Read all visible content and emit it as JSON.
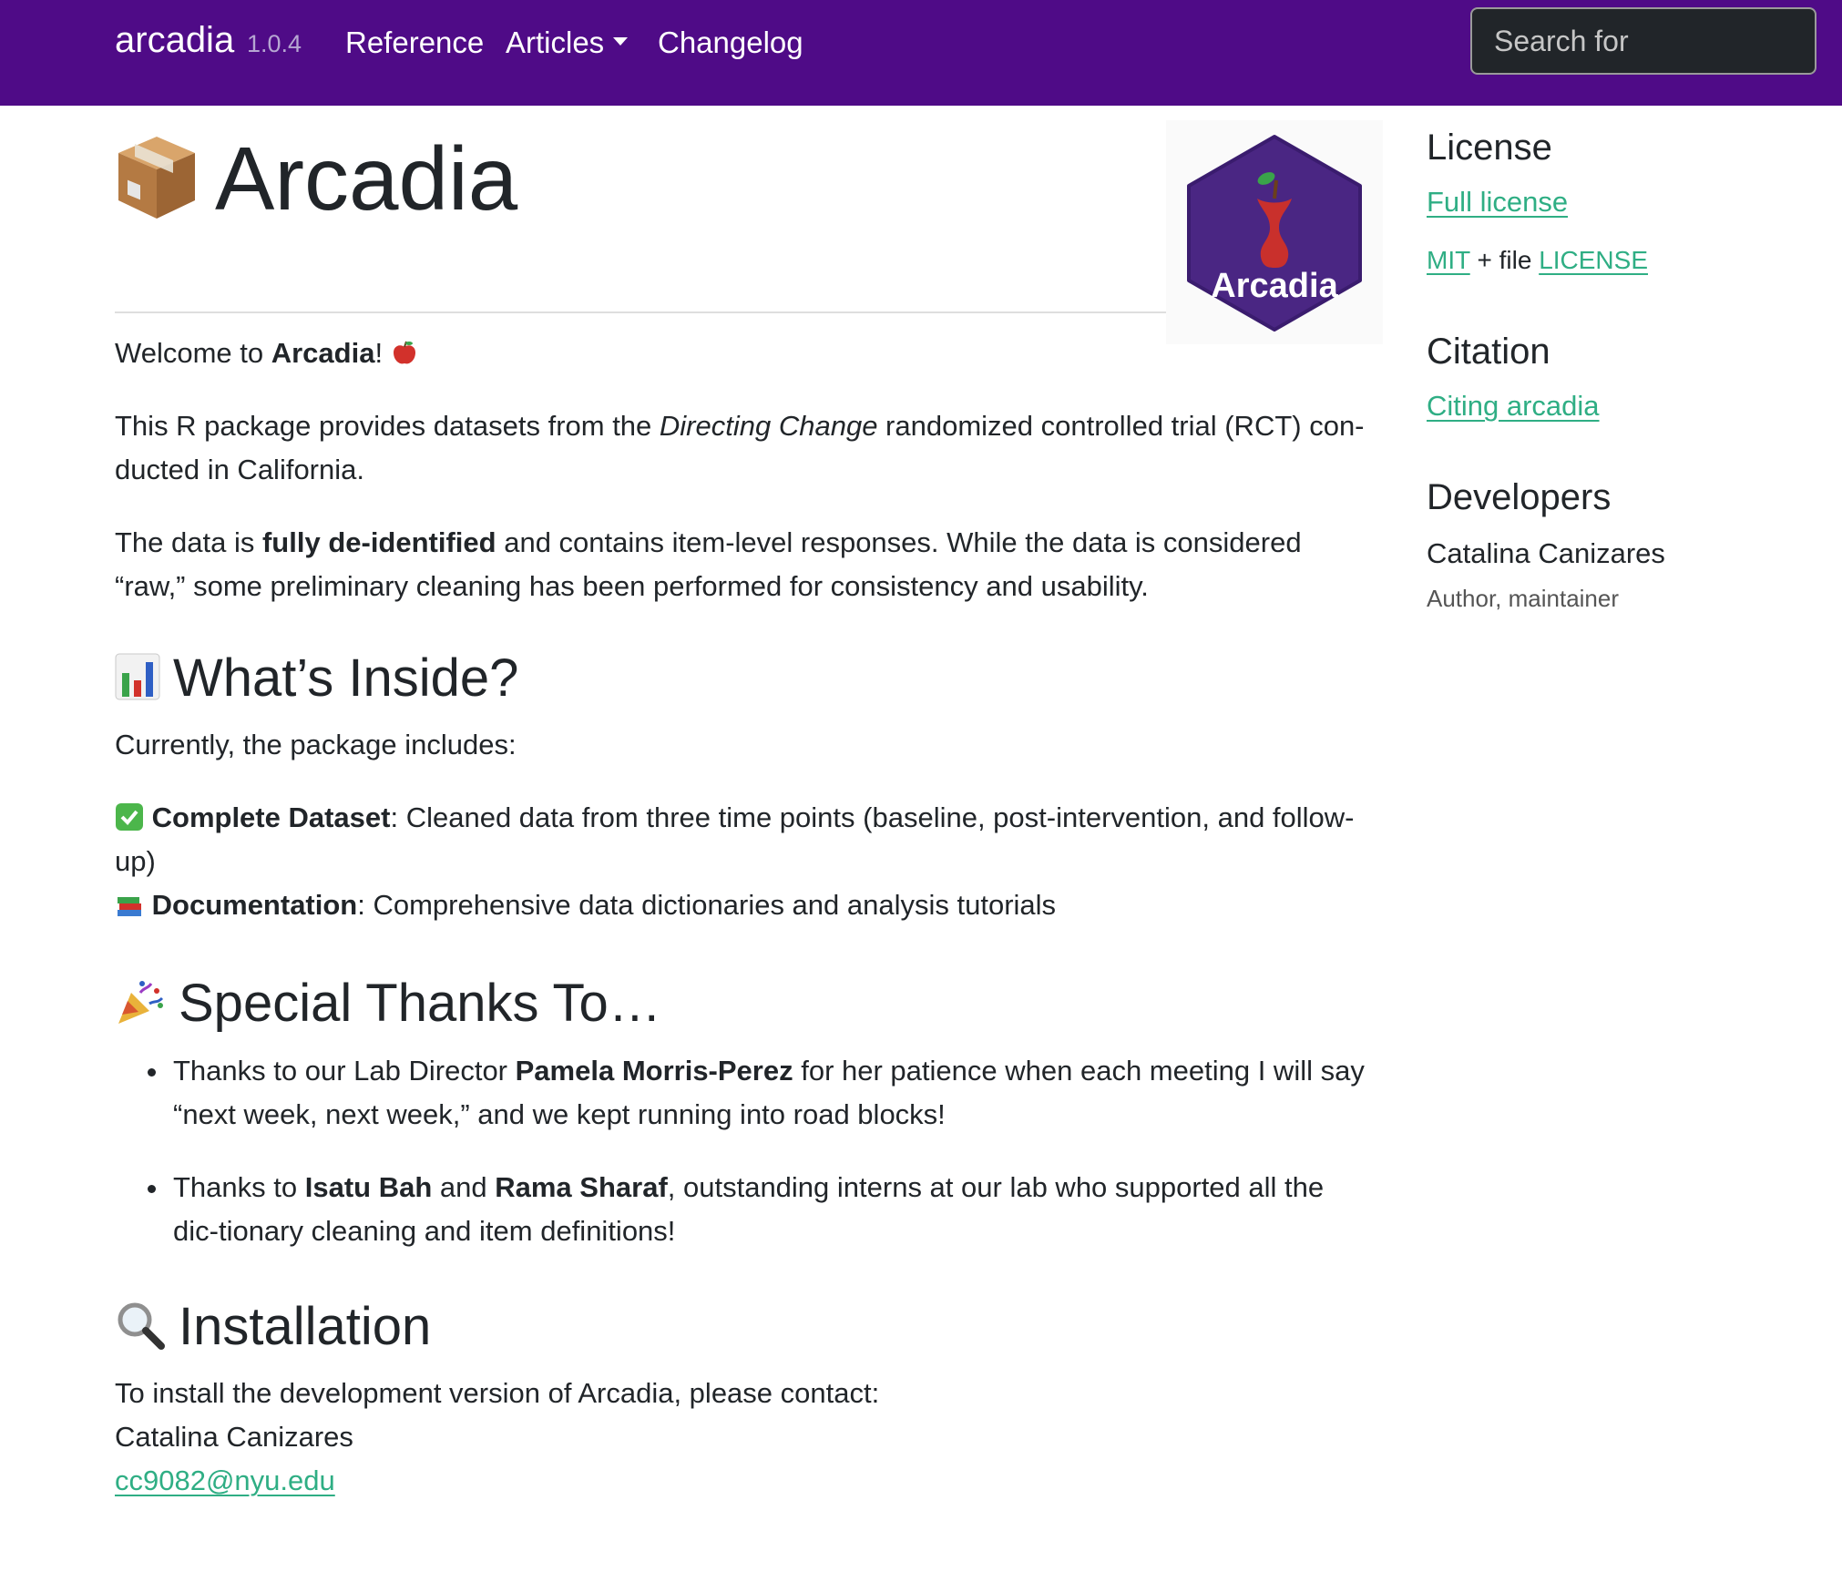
{
  "navbar": {
    "brand": "arcadia",
    "version": "1.0.4",
    "links": [
      {
        "label": "Reference"
      },
      {
        "label": "Articles"
      },
      {
        "label": "Changelog"
      }
    ],
    "search_placeholder": "Search for"
  },
  "main": {
    "title": "Arcadia",
    "logo_text": "Arcadia",
    "welcome": {
      "pre": "Welcome to ",
      "bold": "Arcadia",
      "post": "!"
    },
    "para1": {
      "pre": "This R package provides datasets from the ",
      "italic": "Directing Change",
      "post": " randomized controlled trial (RCT) con-ducted in California."
    },
    "para2": {
      "pre": "The data is ",
      "bold": "fully de-identified",
      "post": " and contains item-level responses. While the data is considered “raw,” some preliminary cleaning has been performed for consistency and usability."
    },
    "section_inside": {
      "heading": "What’s Inside?",
      "intro": "Currently, the package includes:",
      "items": [
        {
          "bold": "Complete Dataset",
          "text": ": Cleaned data from three time points (baseline, post-intervention, and follow-up)"
        },
        {
          "bold": "Documentation",
          "text": ": Comprehensive data dictionaries and analysis tutorials"
        }
      ]
    },
    "section_thanks": {
      "heading": "Special Thanks To…",
      "items": [
        {
          "pre": "Thanks to our Lab Director ",
          "b1": "Pamela Morris-Perez",
          "post": " for her patience when each meeting I will say “next week, next week,” and we kept running into road blocks!"
        },
        {
          "pre": "Thanks to ",
          "b1": "Isatu Bah",
          "mid": " and ",
          "b2": "Rama Sharaf",
          "post": ", outstanding interns at our lab who supported all the dic-tionary cleaning and item definitions!"
        }
      ]
    },
    "section_install": {
      "heading": "Installation",
      "line1": "To install the development version of Arcadia, please contact:",
      "line2": "Catalina Canizares",
      "email": "cc9082@nyu.edu"
    }
  },
  "sidebar": {
    "license": {
      "heading": "License",
      "full_license": "Full license",
      "mit": "MIT",
      "plus_file": " + file ",
      "license_link": "LICENSE"
    },
    "citation": {
      "heading": "Citation",
      "link": "Citing arcadia"
    },
    "developers": {
      "heading": "Developers",
      "name": "Catalina Canizares",
      "role": "Author, maintainer"
    }
  },
  "colors": {
    "navbar": "#4f0b87",
    "link": "#2fae84",
    "logo_hex": "#4a2683"
  }
}
